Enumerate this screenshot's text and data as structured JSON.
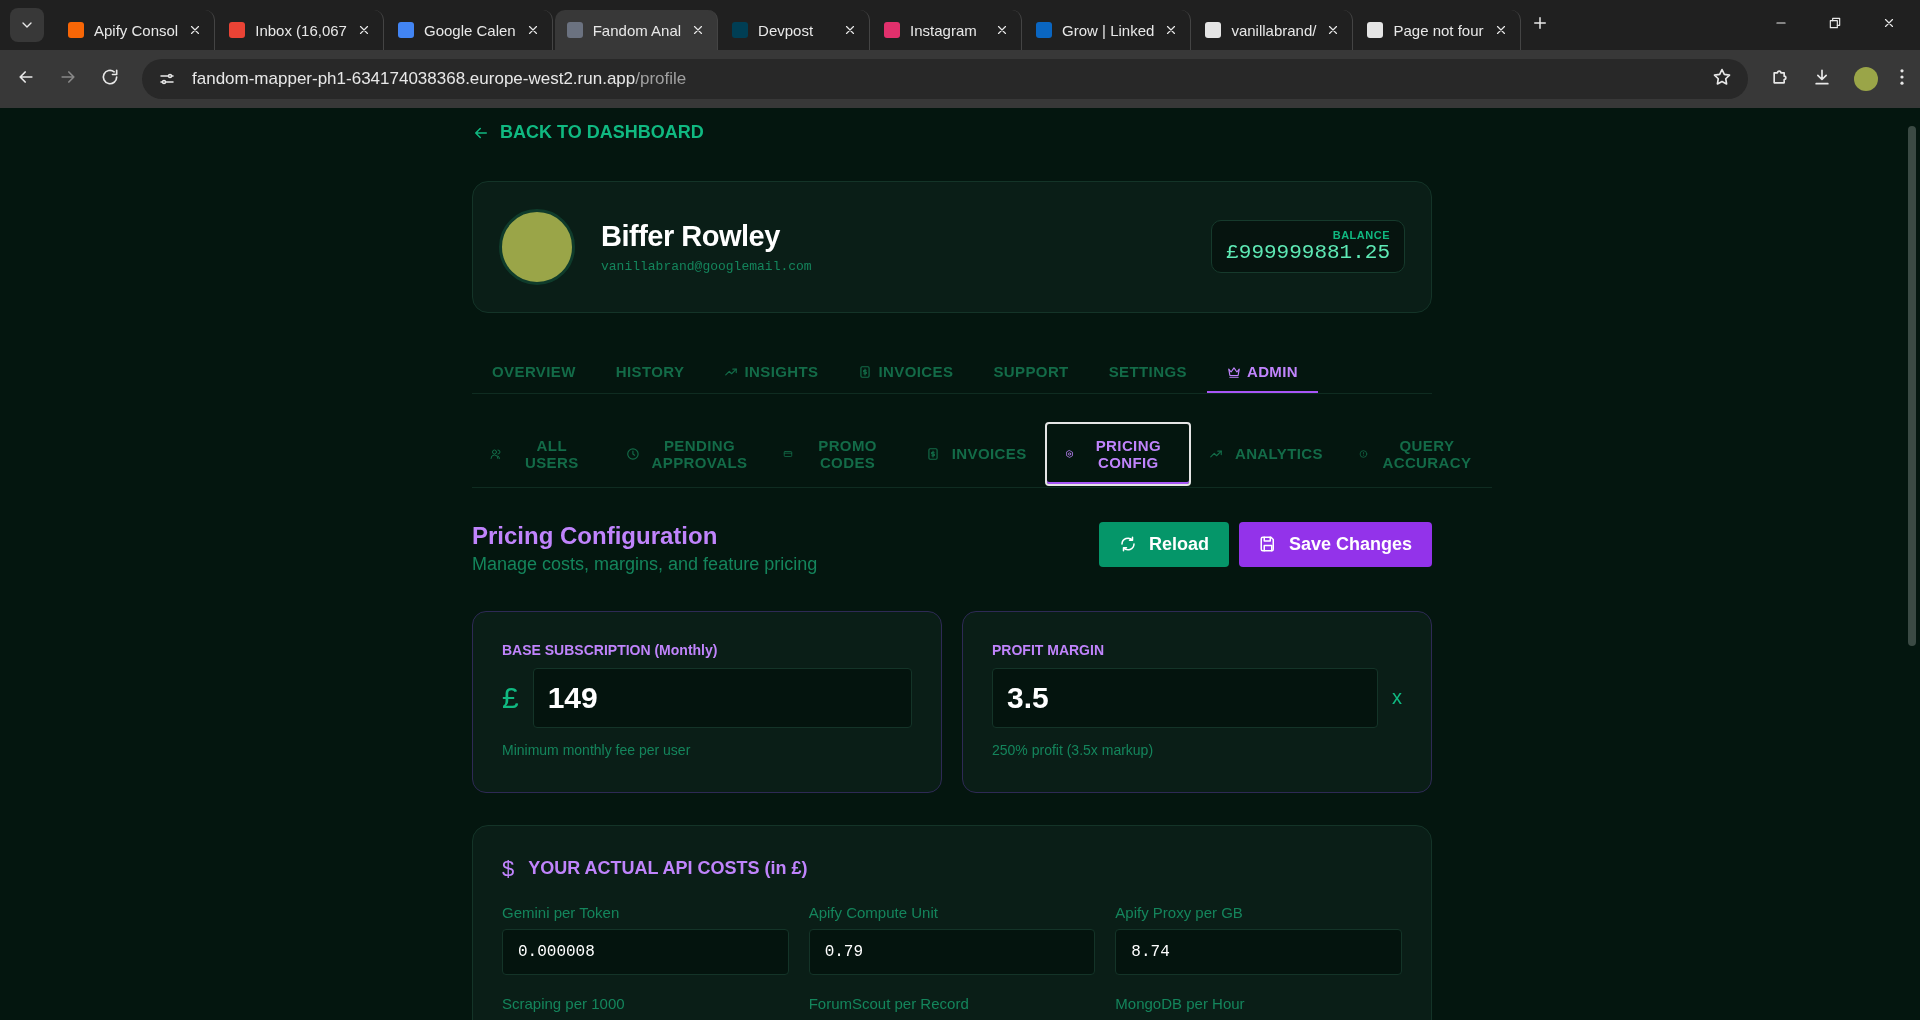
{
  "browser": {
    "tabs": [
      {
        "title": "Apify Consol",
        "color": "#f86606",
        "selected": false
      },
      {
        "title": "Inbox (16,067",
        "color": "#ea4335",
        "selected": false
      },
      {
        "title": "Google Calen",
        "color": "#4285f4",
        "selected": false
      },
      {
        "title": "Fandom Anal",
        "color": "#6b7280",
        "selected": true
      },
      {
        "title": "Devpost",
        "color": "#003e54",
        "selected": false
      },
      {
        "title": "Instagram",
        "color": "#e1306c",
        "selected": false
      },
      {
        "title": "Grow | Linked",
        "color": "#0a66c2",
        "selected": false
      },
      {
        "title": "vanillabrand/",
        "color": "#e5e5e5",
        "selected": false
      },
      {
        "title": "Page not four",
        "color": "#e5e5e5",
        "selected": false
      }
    ],
    "url": "fandom-mapper-ph1-634174038368.europe-west2.run.app",
    "url_path": "/profile"
  },
  "back_link": "BACK TO DASHBOARD",
  "profile": {
    "name": "Biffer Rowley",
    "email": "vanillabrand@googlemail.com",
    "balance_label": "BALANCE",
    "balance": "£999999881.25"
  },
  "nav_tabs": [
    {
      "label": "OVERVIEW",
      "selected": false
    },
    {
      "label": "HISTORY",
      "selected": false
    },
    {
      "label": "INSIGHTS",
      "selected": false
    },
    {
      "label": "INVOICES",
      "selected": false
    },
    {
      "label": "SUPPORT",
      "selected": false
    },
    {
      "label": "SETTINGS",
      "selected": false
    },
    {
      "label": "ADMIN",
      "selected": true
    }
  ],
  "admin_tabs": [
    {
      "label": "ALL USERS",
      "selected": false
    },
    {
      "label": "PENDING APPROVALS",
      "selected": false
    },
    {
      "label": "PROMO CODES",
      "selected": false
    },
    {
      "label": "INVOICES",
      "selected": false
    },
    {
      "label": "PRICING CONFIG",
      "selected": true
    },
    {
      "label": "ANALYTICS",
      "selected": false
    },
    {
      "label": "QUERY ACCURACY",
      "selected": false
    }
  ],
  "pricing": {
    "title": "Pricing Configuration",
    "subtitle": "Manage costs, margins, and feature pricing",
    "reload_button": "Reload",
    "save_button": "Save Changes",
    "base_subscription": {
      "label": "BASE SUBSCRIPTION (Monthly)",
      "prefix": "£",
      "value": "149",
      "hint": "Minimum monthly fee per user"
    },
    "profit_margin": {
      "label": "PROFIT MARGIN",
      "value": "3.5",
      "suffix": "x",
      "hint": "250% profit (3.5x markup)"
    },
    "api_costs": {
      "icon": "$",
      "title": "YOUR ACTUAL API COSTS (in £)",
      "fields": [
        {
          "label": "Gemini per Token",
          "value": "0.000008"
        },
        {
          "label": "Apify Compute Unit",
          "value": "0.79"
        },
        {
          "label": "Apify Proxy per GB",
          "value": "8.74"
        },
        {
          "label": "Scraping per 1000"
        },
        {
          "label": "ForumScout per Record"
        },
        {
          "label": "MongoDB per Hour"
        }
      ]
    }
  }
}
